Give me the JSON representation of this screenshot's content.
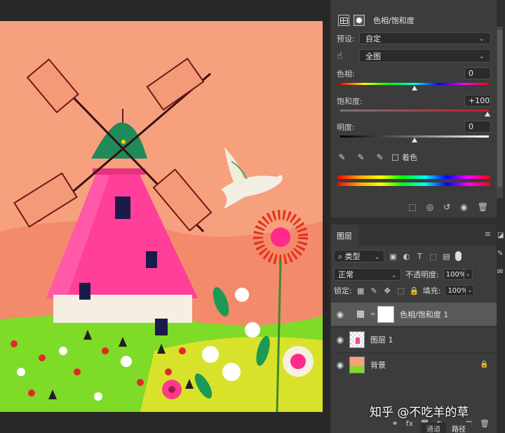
{
  "properties_panel": {
    "title": "色相/饱和度",
    "preset": {
      "label": "预设:",
      "value": "自定"
    },
    "channel": {
      "value": "全图"
    },
    "hue": {
      "label": "色相:",
      "value": "0"
    },
    "saturation": {
      "label": "饱和度:",
      "value": "+100"
    },
    "lightness": {
      "label": "明度:",
      "value": "0"
    },
    "colorize": {
      "label": "着色"
    },
    "icons": [
      "adjustment-layer-icon",
      "mask-icon",
      "hand-icon",
      "eyedropper-icon",
      "eyedropper-plus-icon",
      "eyedropper-minus-icon",
      "clip-to-layer-icon",
      "view-previous-icon",
      "reset-icon",
      "visibility-icon",
      "trash-icon"
    ]
  },
  "layers_panel": {
    "tab": "图层",
    "filter_kind": "类型",
    "blend_mode": "正常",
    "opacity": {
      "label": "不透明度:",
      "value": "100%"
    },
    "lock": {
      "label": "锁定:"
    },
    "fill": {
      "label": "填充:",
      "value": "100%"
    },
    "layers": [
      {
        "name": "色相/饱和度 1",
        "type": "adjustment",
        "selected": true
      },
      {
        "name": "图层 1",
        "type": "pixel",
        "selected": false
      },
      {
        "name": "背景",
        "type": "background",
        "selected": false,
        "locked": true
      }
    ],
    "footer_icons": [
      "link-icon",
      "fx-icon",
      "add-mask-icon",
      "adjustment-icon",
      "group-icon",
      "new-layer-icon",
      "trash-icon"
    ]
  },
  "bottom_tabs": [
    "通道",
    "路径"
  ],
  "watermark": "知乎 @不吃羊的草",
  "colors": {
    "background": "#282828",
    "panel": "#3c3c3c",
    "artwork_sky": "#f7a07e",
    "windmill_pink": "#ff3f9a",
    "windmill_roof": "#1f8a5a",
    "grass": "#6fd424"
  }
}
